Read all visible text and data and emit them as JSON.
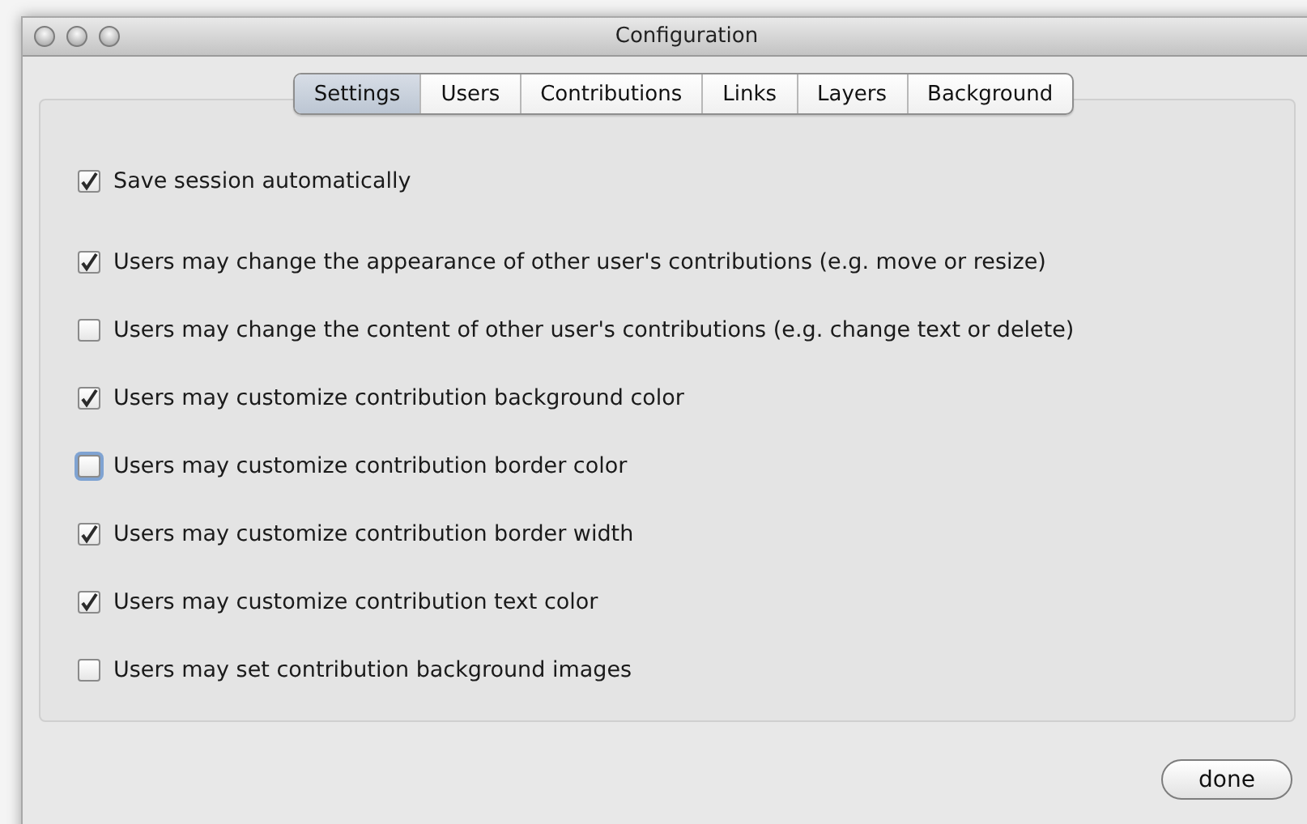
{
  "window": {
    "title": "Configuration"
  },
  "tabs": [
    {
      "label": "Settings",
      "selected": true
    },
    {
      "label": "Users",
      "selected": false
    },
    {
      "label": "Contributions",
      "selected": false
    },
    {
      "label": "Links",
      "selected": false
    },
    {
      "label": "Layers",
      "selected": false
    },
    {
      "label": "Background",
      "selected": false
    }
  ],
  "sections": [
    {
      "options": [
        {
          "label": "Save session automatically",
          "checked": true,
          "focused": false
        }
      ]
    },
    {
      "options": [
        {
          "label": "Users may change the appearance of other user's contributions (e.g. move or resize)",
          "checked": true,
          "focused": false
        },
        {
          "label": "Users may change the content of other user's contributions (e.g. change text or delete)",
          "checked": false,
          "focused": false
        },
        {
          "label": "Users may customize contribution background color",
          "checked": true,
          "focused": false
        },
        {
          "label": "Users may customize contribution border color",
          "checked": false,
          "focused": true
        },
        {
          "label": "Users may customize contribution border width",
          "checked": true,
          "focused": false
        },
        {
          "label": "Users may customize contribution text color",
          "checked": true,
          "focused": false
        },
        {
          "label": "Users may set contribution background images",
          "checked": false,
          "focused": false
        }
      ]
    }
  ],
  "buttons": [
    {
      "label": "done"
    }
  ]
}
